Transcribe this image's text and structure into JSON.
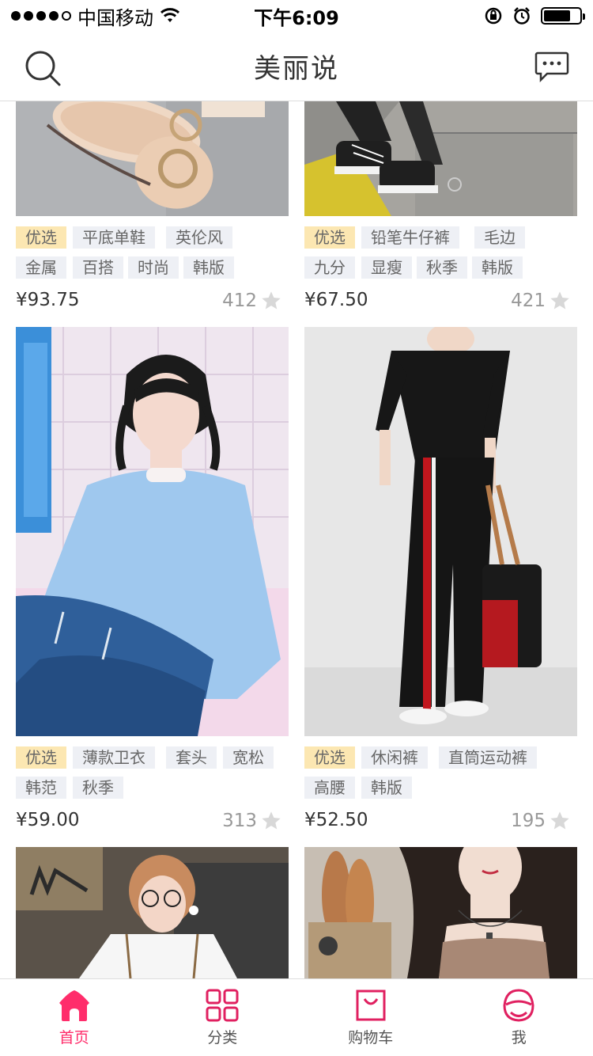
{
  "status_bar": {
    "carrier": "中国移动",
    "time": "下午6:09",
    "battery_level": 0.75
  },
  "nav": {
    "title": "美丽说",
    "left_icon": "search-icon",
    "right_icon": "message-icon"
  },
  "products": [
    {
      "tags": [
        "优选",
        "平底单鞋",
        "英伦风",
        "金属",
        "百搭",
        "时尚",
        "韩版"
      ],
      "price": "¥93.75",
      "likes": "412",
      "image": "flat-shoes-photo"
    },
    {
      "tags": [
        "优选",
        "铅笔牛仔裤",
        "毛边",
        "九分",
        "显瘦",
        "秋季",
        "韩版"
      ],
      "price": "¥67.50",
      "likes": "421",
      "image": "sneakers-jeans-photo"
    },
    {
      "tags": [
        "优选",
        "薄款卫衣",
        "套头",
        "宽松",
        "韩范",
        "秋季"
      ],
      "price": "¥59.00",
      "likes": "313",
      "image": "blue-sweatshirt-photo"
    },
    {
      "tags": [
        "优选",
        "休闲裤",
        "直筒运动裤",
        "高腰",
        "韩版"
      ],
      "price": "¥52.50",
      "likes": "195",
      "image": "striped-pants-photo"
    },
    {
      "image": "white-shirt-photo"
    },
    {
      "image": "camisole-photo"
    }
  ],
  "tab_bar": {
    "items": [
      {
        "label": "首页",
        "icon": "home-icon",
        "active": true
      },
      {
        "label": "分类",
        "icon": "grid-icon",
        "active": false
      },
      {
        "label": "购物车",
        "icon": "shopping-bag-icon",
        "active": false
      },
      {
        "label": "我",
        "icon": "profile-icon",
        "active": false
      }
    ]
  },
  "colors": {
    "accent": "#ff2d6b",
    "tag_bg": "#eef0f5",
    "selected_tag_bg": "#fce7b2"
  }
}
